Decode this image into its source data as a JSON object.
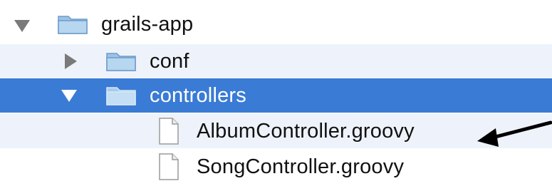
{
  "tree": {
    "root": {
      "label": "grails-app",
      "expanded": true,
      "icon": "folder-icon"
    },
    "conf": {
      "label": "conf",
      "expanded": false,
      "icon": "folder-icon"
    },
    "controllers": {
      "label": "controllers",
      "expanded": true,
      "selected": true,
      "icon": "folder-icon"
    },
    "files": [
      {
        "label": "AlbumController.groovy",
        "icon": "document-icon"
      },
      {
        "label": "SongController.groovy",
        "icon": "document-icon"
      }
    ]
  },
  "annotation": {
    "icon": "arrow-icon",
    "points_to": "AlbumController.groovy"
  },
  "colors": {
    "selection": "#3a7bd5",
    "alternate_row": "#eef3fb",
    "disclosure": "#7a7a7a",
    "text": "#111111"
  }
}
